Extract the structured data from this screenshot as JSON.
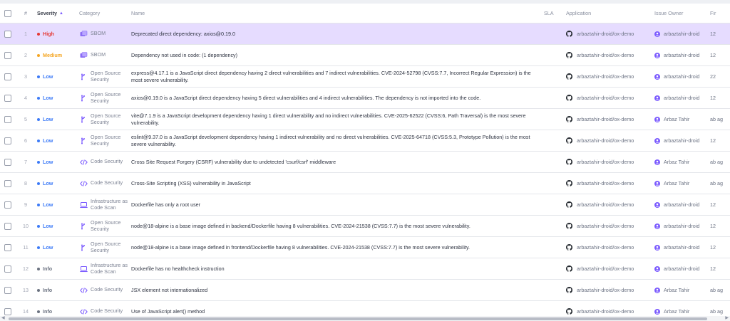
{
  "colors": {
    "High": "#e53935",
    "Medium": "#f5a623",
    "Low": "#3d7bf7",
    "Info": "#6b7280",
    "accent": "#7c5cff"
  },
  "header": {
    "num": "#",
    "severity": "Severity",
    "category": "Category",
    "name": "Name",
    "sla": "SLA",
    "application": "Application",
    "owner": "Issue Owner",
    "first": "Fir"
  },
  "rows": [
    {
      "num": "1",
      "severity": "High",
      "category": "SBOM",
      "cat_icon": "sbom-icon",
      "name": "Deprecated direct dependency: axios@0.19.0",
      "application": "arbaztahir-droid/ox-demo",
      "owner": "arbaztahir-droid",
      "first": "12",
      "selected": true
    },
    {
      "num": "2",
      "severity": "Medium",
      "category": "SBOM",
      "cat_icon": "sbom-icon",
      "name": "Dependency not used in code: (1 dependency)",
      "application": "arbaztahir-droid/ox-demo",
      "owner": "arbaztahir-droid",
      "first": "12"
    },
    {
      "num": "3",
      "severity": "Low",
      "category": "Open Source Security",
      "cat_icon": "open-source-icon",
      "name": "express@4.17.1 is a JavaScript direct dependency having 2 direct vulnerabilities and 7 indirect vulnerabilities. CVE-2024-52798 (CVSS:7.7, Incorrect Regular Expression) is the most severe vulnerability.",
      "application": "arbaztahir-droid/ox-demo",
      "owner": "arbaztahir-droid",
      "first": "22"
    },
    {
      "num": "4",
      "severity": "Low",
      "category": "Open Source Security",
      "cat_icon": "open-source-icon",
      "name": "axios@0.19.0 is a JavaScript direct dependency having 5 direct vulnerabilities and 4 indirect vulnerabilities. The dependency is not imported into the code.",
      "application": "arbaztahir-droid/ox-demo",
      "owner": "arbaztahir-droid",
      "first": "12"
    },
    {
      "num": "5",
      "severity": "Low",
      "category": "Open Source Security",
      "cat_icon": "open-source-icon",
      "name": "vite@7.1.9 is a JavaScript development dependency having 1 direct vulnerability and no indirect vulnerabilities. CVE-2025-62522 (CVSS:6, Path Traversal) is the most severe vulnerability.",
      "application": "arbaztahir-droid/ox-demo",
      "owner": "Arbaz Tahir",
      "first": "ab ag"
    },
    {
      "num": "6",
      "severity": "Low",
      "category": "Open Source Security",
      "cat_icon": "open-source-icon",
      "name": "eslint@9.37.0 is a JavaScript development dependency having 1 indirect vulnerability and no direct vulnerabilities. CVE-2025-64718 (CVSS:5.3, Prototype Pollution) is the most severe vulnerability.",
      "application": "arbaztahir-droid/ox-demo",
      "owner": "arbaztahir-droid",
      "first": "12"
    },
    {
      "num": "7",
      "severity": "Low",
      "category": "Code Security",
      "cat_icon": "code-icon",
      "name": "Cross Site Request Forgery (CSRF) vulnerability due to undetected 'csurf/csrf' middleware",
      "application": "arbaztahir-droid/ox-demo",
      "owner": "Arbaz Tahir",
      "first": "ab ag"
    },
    {
      "num": "8",
      "severity": "Low",
      "category": "Code Security",
      "cat_icon": "code-icon",
      "name": "Cross-Site Scripting (XSS) vulnerability in JavaScript",
      "application": "arbaztahir-droid/ox-demo",
      "owner": "Arbaz Tahir",
      "first": "ab ag"
    },
    {
      "num": "9",
      "severity": "Low",
      "category": "Infrastructure as Code Scan",
      "cat_icon": "laptop-icon",
      "name": "Dockerfile has only a root user",
      "application": "arbaztahir-droid/ox-demo",
      "owner": "arbaztahir-droid",
      "first": "12"
    },
    {
      "num": "10",
      "severity": "Low",
      "category": "Open Source Security",
      "cat_icon": "open-source-icon",
      "name": "node@18-alpine is a base image defined in backend/Dockerfile having 8 vulnerabilities. CVE-2024-21538 (CVSS:7.7) is the most severe vulnerability.",
      "application": "arbaztahir-droid/ox-demo",
      "owner": "arbaztahir-droid",
      "first": "12"
    },
    {
      "num": "11",
      "severity": "Low",
      "category": "Open Source Security",
      "cat_icon": "open-source-icon",
      "name": "node@18-alpine is a base image defined in frontend/Dockerfile having 8 vulnerabilities. CVE-2024-21538 (CVSS:7.7) is the most severe vulnerability.",
      "application": "arbaztahir-droid/ox-demo",
      "owner": "arbaztahir-droid",
      "first": "12"
    },
    {
      "num": "12",
      "severity": "Info",
      "category": "Infrastructure as Code Scan",
      "cat_icon": "laptop-icon",
      "name": "Dockerfile has no healthcheck instruction",
      "application": "arbaztahir-droid/ox-demo",
      "owner": "arbaztahir-droid",
      "first": "12"
    },
    {
      "num": "13",
      "severity": "Info",
      "category": "Code Security",
      "cat_icon": "code-icon",
      "name": "JSX element not internationalized",
      "application": "arbaztahir-droid/ox-demo",
      "owner": "Arbaz Tahir",
      "first": "ab ag"
    },
    {
      "num": "14",
      "severity": "Info",
      "category": "Code Security",
      "cat_icon": "code-icon",
      "name": "Use of JavaScript alert() method",
      "application": "arbaztahir-droid/ox-demo",
      "owner": "Arbaz Tahir",
      "first": "ab ag"
    }
  ]
}
